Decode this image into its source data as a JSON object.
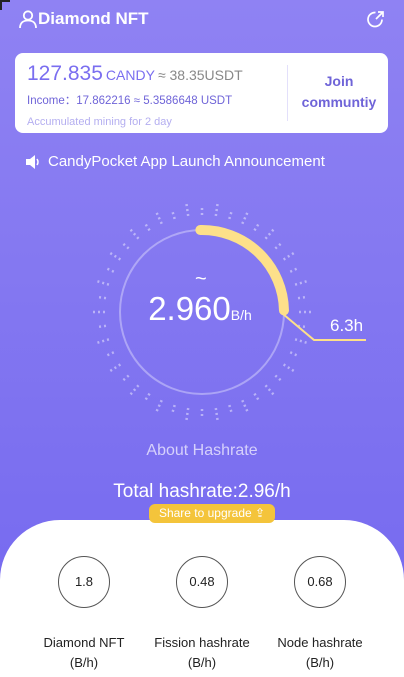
{
  "header": {
    "title": "Diamond NFT",
    "user_icon": "user-icon",
    "share_icon": "share-icon"
  },
  "balance": {
    "amount": "127.835",
    "unit": "CANDY",
    "usdt_equiv": "≈ 38.35USDT",
    "income": "Income：17.862216 ≈ 5.3586648 USDT",
    "accumulated": "Accumulated mining for 2 day",
    "join_label": "Join communtiy"
  },
  "announcement": {
    "icon": "speaker-icon",
    "text": "CandyPocket App Launch Announcement"
  },
  "gauge": {
    "value": "2.960",
    "unit": "B/h",
    "tilde": "~",
    "time_label": "6.3h",
    "progress": 0.25
  },
  "about_label": "About Hashrate",
  "total_hashrate": "Total hashrate:2.96/h",
  "upgrade_button": "Share to upgrade ⇪",
  "stats": [
    {
      "value": "1.8",
      "label": "Diamond NFT",
      "unit": "(B/h)"
    },
    {
      "value": "0.48",
      "label": "Fission hashrate",
      "unit": "(B/h)"
    },
    {
      "value": "0.68",
      "label": "Node hashrate",
      "unit": "(B/h)"
    }
  ],
  "colors": {
    "accent": "#7a6ef0",
    "gauge_arc": "#fde08a",
    "button": "#f4c43b"
  }
}
